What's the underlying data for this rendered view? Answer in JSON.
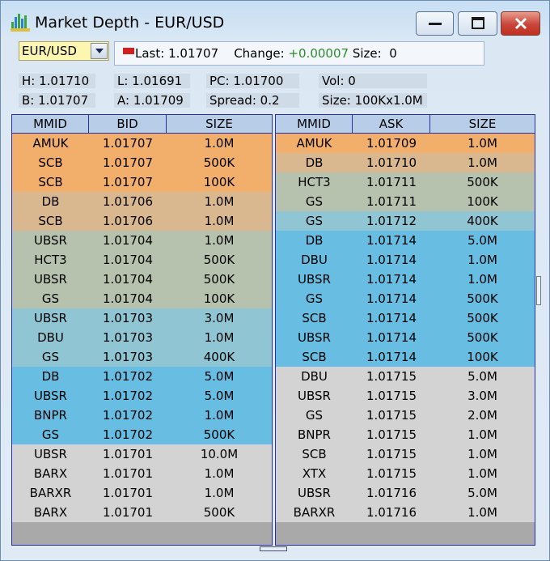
{
  "window": {
    "title": "Market Depth - EUR/USD",
    "minimize_icon": "minimize-icon",
    "maximize_icon": "maximize-icon",
    "close_icon": "close-icon"
  },
  "toolbar": {
    "pair_value": "EUR/USD",
    "last_label": "Last:",
    "last_value": "1.01707",
    "change_label": "Change:",
    "change_value": "+0.00007",
    "size_label": "Size:",
    "size_value": "0"
  },
  "stats": {
    "high": "H: 1.01710",
    "low": "L: 1.01691",
    "prev_close": "PC: 1.01700",
    "volume": "Vol: 0",
    "bid": "B: 1.01707",
    "ask": "A: 1.01709",
    "spread": "Spread: 0.2",
    "size": "Size: 100Kx1.0M"
  },
  "colors": {
    "level1": "#f2ae6b",
    "level2": "#d9b88f",
    "level3": "#b6c2ad",
    "level4": "#90c6d4",
    "level5": "#67bde2",
    "level6": "#d3d3d3"
  },
  "bid_table": {
    "headers": [
      "MMID",
      "BID",
      "SIZE"
    ],
    "rows": [
      {
        "mmid": "AMUK",
        "price": "1.01707",
        "size": "1.0M",
        "level": 1
      },
      {
        "mmid": "SCB",
        "price": "1.01707",
        "size": "500K",
        "level": 1
      },
      {
        "mmid": "SCB",
        "price": "1.01707",
        "size": "100K",
        "level": 1
      },
      {
        "mmid": "DB",
        "price": "1.01706",
        "size": "1.0M",
        "level": 2
      },
      {
        "mmid": "SCB",
        "price": "1.01706",
        "size": "1.0M",
        "level": 2
      },
      {
        "mmid": "UBSR",
        "price": "1.01704",
        "size": "1.0M",
        "level": 3
      },
      {
        "mmid": "HCT3",
        "price": "1.01704",
        "size": "500K",
        "level": 3
      },
      {
        "mmid": "UBSR",
        "price": "1.01704",
        "size": "500K",
        "level": 3
      },
      {
        "mmid": "GS",
        "price": "1.01704",
        "size": "100K",
        "level": 3
      },
      {
        "mmid": "UBSR",
        "price": "1.01703",
        "size": "3.0M",
        "level": 4
      },
      {
        "mmid": "DBU",
        "price": "1.01703",
        "size": "1.0M",
        "level": 4
      },
      {
        "mmid": "GS",
        "price": "1.01703",
        "size": "400K",
        "level": 4
      },
      {
        "mmid": "DB",
        "price": "1.01702",
        "size": "5.0M",
        "level": 5
      },
      {
        "mmid": "UBSR",
        "price": "1.01702",
        "size": "5.0M",
        "level": 5
      },
      {
        "mmid": "BNPR",
        "price": "1.01702",
        "size": "1.0M",
        "level": 5
      },
      {
        "mmid": "GS",
        "price": "1.01702",
        "size": "500K",
        "level": 5
      },
      {
        "mmid": "UBSR",
        "price": "1.01701",
        "size": "10.0M",
        "level": 6
      },
      {
        "mmid": "BARX",
        "price": "1.01701",
        "size": "1.0M",
        "level": 6
      },
      {
        "mmid": "BARXR",
        "price": "1.01701",
        "size": "1.0M",
        "level": 6
      },
      {
        "mmid": "BARX",
        "price": "1.01701",
        "size": "500K",
        "level": 6
      }
    ]
  },
  "ask_table": {
    "headers": [
      "MMID",
      "ASK",
      "SIZE"
    ],
    "rows": [
      {
        "mmid": "AMUK",
        "price": "1.01709",
        "size": "1.0M",
        "level": 1
      },
      {
        "mmid": "DB",
        "price": "1.01710",
        "size": "1.0M",
        "level": 2
      },
      {
        "mmid": "HCT3",
        "price": "1.01711",
        "size": "500K",
        "level": 3
      },
      {
        "mmid": "GS",
        "price": "1.01711",
        "size": "100K",
        "level": 3
      },
      {
        "mmid": "GS",
        "price": "1.01712",
        "size": "400K",
        "level": 4
      },
      {
        "mmid": "DB",
        "price": "1.01714",
        "size": "5.0M",
        "level": 5
      },
      {
        "mmid": "DBU",
        "price": "1.01714",
        "size": "1.0M",
        "level": 5
      },
      {
        "mmid": "UBSR",
        "price": "1.01714",
        "size": "1.0M",
        "level": 5
      },
      {
        "mmid": "GS",
        "price": "1.01714",
        "size": "500K",
        "level": 5
      },
      {
        "mmid": "SCB",
        "price": "1.01714",
        "size": "500K",
        "level": 5
      },
      {
        "mmid": "UBSR",
        "price": "1.01714",
        "size": "500K",
        "level": 5
      },
      {
        "mmid": "SCB",
        "price": "1.01714",
        "size": "100K",
        "level": 5
      },
      {
        "mmid": "DBU",
        "price": "1.01715",
        "size": "5.0M",
        "level": 6
      },
      {
        "mmid": "UBSR",
        "price": "1.01715",
        "size": "3.0M",
        "level": 6
      },
      {
        "mmid": "GS",
        "price": "1.01715",
        "size": "2.0M",
        "level": 6
      },
      {
        "mmid": "BNPR",
        "price": "1.01715",
        "size": "1.0M",
        "level": 6
      },
      {
        "mmid": "SCB",
        "price": "1.01715",
        "size": "1.0M",
        "level": 6
      },
      {
        "mmid": "XTX",
        "price": "1.01715",
        "size": "1.0M",
        "level": 6
      },
      {
        "mmid": "UBSR",
        "price": "1.01716",
        "size": "5.0M",
        "level": 6
      },
      {
        "mmid": "BARXR",
        "price": "1.01716",
        "size": "1.0M",
        "level": 6
      }
    ]
  }
}
